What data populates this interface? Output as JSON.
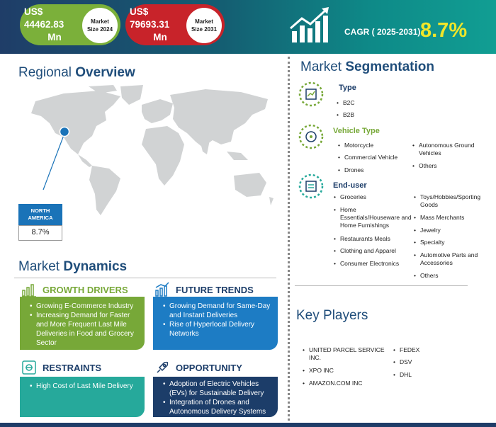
{
  "header": {
    "market_2024": {
      "line1": "US$ 44462.83",
      "line2": "Mn",
      "label1": "Market",
      "label2": "Size 2024"
    },
    "market_2031": {
      "line1": "US$ 79693.31",
      "line2": "Mn",
      "label1": "Market",
      "label2": "Size 2031"
    },
    "cagr_label": "CAGR ( 2025-2031)",
    "cagr_value": "8.7%"
  },
  "regional": {
    "title_a": "Regional ",
    "title_b": "Overview",
    "region_line1": "NORTH",
    "region_line2": "AMERICA",
    "region_value": "8.7%"
  },
  "dynamics": {
    "title_a": "Market ",
    "title_b": "Dynamics",
    "growth_drivers": {
      "title": "GROWTH DRIVERS",
      "items": [
        "Growing E-Commerce Industry",
        "Increasing Demand for Faster and More Frequent Last Mile Deliveries in Food and Grocery Sector"
      ]
    },
    "future_trends": {
      "title": "FUTURE TRENDS",
      "items": [
        "Growing Demand for Same-Day and Instant Deliveries",
        "Rise of Hyperlocal Delivery Networks"
      ]
    },
    "restraints": {
      "title": "RESTRAINTS",
      "items": [
        "High Cost of Last Mile Delivery"
      ]
    },
    "opportunity": {
      "title": "OPPORTUNITY",
      "items": [
        "Adoption of Electric Vehicles (EVs) for Sustainable Delivery",
        "Integration of Drones and Autonomous Delivery Systems"
      ]
    }
  },
  "segmentation": {
    "title_a": "Market ",
    "title_b": "Segmentation",
    "type": {
      "title": "Type",
      "items": [
        "B2C",
        "B2B"
      ]
    },
    "vehicle": {
      "title": "Vehicle Type",
      "col1": [
        "Motorcycle",
        "Commercial Vehicle",
        "Drones"
      ],
      "col2": [
        "Autonomous Ground Vehicles",
        "Others"
      ]
    },
    "end_user": {
      "title": "End-user",
      "col1": [
        "Groceries",
        "Home Essentials/Houseware and Home Furnishings",
        "Restaurants Meals",
        "Clothing and Apparel",
        "Consumer Electronics"
      ],
      "col2": [
        "Toys/Hobbies/Sporting Goods",
        "Mass Merchants",
        "Jewelry",
        "Specialty",
        "Automotive Parts and Accessories",
        "Others"
      ]
    }
  },
  "key_players": {
    "title": "Key Players",
    "col1": [
      "UNITED PARCEL SERVICE INC.",
      "XPO INC",
      "AMAZON.COM INC"
    ],
    "col2": [
      "FEDEX",
      "DSV",
      "DHL"
    ]
  },
  "colors": {
    "green": "#77a838",
    "blue": "#1d7cc4",
    "teal": "#26a99b",
    "navy": "#1c3d69",
    "red": "#c8232a",
    "cagr": "#f0e62a"
  }
}
